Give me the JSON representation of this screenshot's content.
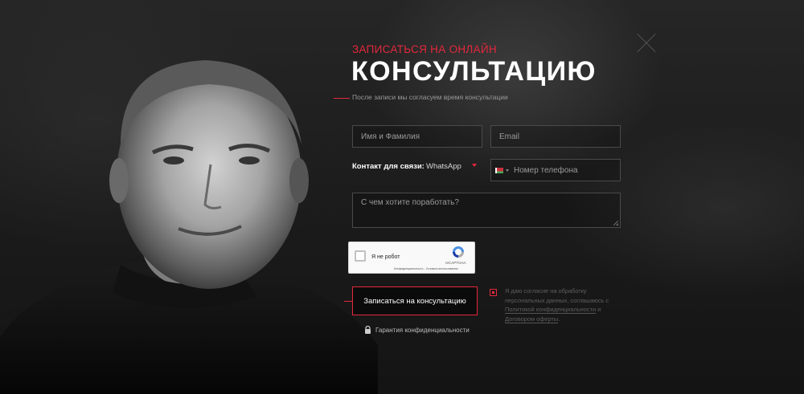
{
  "header": {
    "subheading": "ЗАПИСАТЬСЯ НА ОНЛАЙН",
    "heading": "КОНСУЛЬТАЦИЮ",
    "hint": "После записи мы согласуем время консультации"
  },
  "form": {
    "name_placeholder": "Имя и Фамилия",
    "email_placeholder": "Email",
    "contact_label": "Контакт для связи:",
    "contact_value": "WhatsApp",
    "phone_placeholder": "Номер телефона",
    "message_placeholder": "С чем хотите поработать?",
    "submit_label": "Записаться на консультацию"
  },
  "recaptcha": {
    "label": "Я не робот",
    "brand": "reCAPTCHA",
    "privacy_link": "Конфиденциальность",
    "separator": " - ",
    "terms_link": "Условия использования"
  },
  "consent": {
    "text_before": "Я даю согласие на обработку персональных данных, соглашаюсь с ",
    "policy_link": "Политикой конфиденциальности",
    "text_middle": " и ",
    "offer_link": "Договором оферты",
    "text_after": "."
  },
  "privacy": {
    "label": "Гарантия конфиденциальности"
  },
  "colors": {
    "accent": "#e3283c",
    "background": "#1e1e1e"
  },
  "icons": [
    "close-icon",
    "chevron-down-icon",
    "belarus-flag-icon",
    "recaptcha-logo-icon",
    "lock-icon"
  ]
}
